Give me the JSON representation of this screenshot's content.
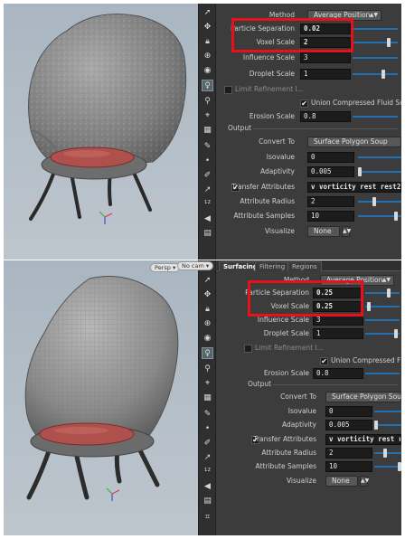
{
  "top": {
    "method_label": "Method",
    "method_value": "Average Position",
    "particle_separation_label": "Particle Separation",
    "particle_separation_value": "0.02",
    "voxel_scale_label": "Voxel Scale",
    "voxel_scale_value": "2",
    "influence_scale_label": "Influence Scale",
    "influence_scale_value": "3",
    "droplet_scale_label": "Droplet Scale",
    "droplet_scale_value": "1",
    "limit_refinement_label": "Limit Refinement I...",
    "union_label": "Union Compressed Fluid Surface",
    "erosion_scale_label": "Erosion Scale",
    "erosion_scale_value": "0.8",
    "output_section": "Output",
    "convert_to_label": "Convert To",
    "convert_to_value": "Surface Polygon Soup",
    "isovalue_label": "Isovalue",
    "isovalue_value": "0",
    "adaptivity_label": "Adaptivity",
    "adaptivity_value": "0.005",
    "transfer_attributes_label": "Transfer Attributes",
    "transfer_attributes_value": "v vorticity rest rest2",
    "attribute_radius_label": "Attribute Radius",
    "attribute_radius_value": "2",
    "attribute_samples_label": "Attribute Samples",
    "attribute_samples_value": "10",
    "visualize_label": "Visualize",
    "visualize_value": "None"
  },
  "bottom": {
    "tabs": [
      "Surfacing",
      "Filtering",
      "Regions"
    ],
    "persp_label": "Persp",
    "cam_label": "No cam",
    "method_label": "Method",
    "method_value": "Average Position",
    "particle_separation_label": "Particle Separation",
    "particle_separation_value": "0.25",
    "voxel_scale_label": "Voxel Scale",
    "voxel_scale_value": "0.25",
    "influence_scale_label": "Influence Scale",
    "influence_scale_value": "3",
    "droplet_scale_label": "Droplet Scale",
    "droplet_scale_value": "1",
    "limit_refinement_label": "Limit Refinement I...",
    "union_label": "Union Compressed Fluid Su",
    "erosion_scale_label": "Erosion Scale",
    "erosion_scale_value": "0.8",
    "output_section": "Output",
    "convert_to_label": "Convert To",
    "convert_to_value": "Surface Polygon Soup",
    "isovalue_label": "Isovalue",
    "isovalue_value": "0",
    "adaptivity_label": "Adaptivity",
    "adaptivity_value": "0.005",
    "transfer_attributes_label": "Transfer Attributes",
    "transfer_attributes_value": "v vorticity rest rest",
    "attribute_radius_label": "Attribute Radius",
    "attribute_radius_value": "2",
    "attribute_samples_label": "Attribute Samples",
    "attribute_samples_value": "10",
    "visualize_label": "Visualize",
    "visualize_value": "None"
  },
  "colors": {
    "highlight_box": "#e8101a",
    "slider": "#1f6fb2",
    "seat_cushion": "#b0504c",
    "chair_shell": "#8a8a8a"
  },
  "icons": [
    "select-icon",
    "transform-icon",
    "lock-icon",
    "handle-icon",
    "view-icon",
    "light-icon",
    "camera-icon",
    "snap-icon",
    "paint-icon",
    "point-icon",
    "pen-icon",
    "number-icon",
    "sound-icon",
    "display-icon"
  ]
}
